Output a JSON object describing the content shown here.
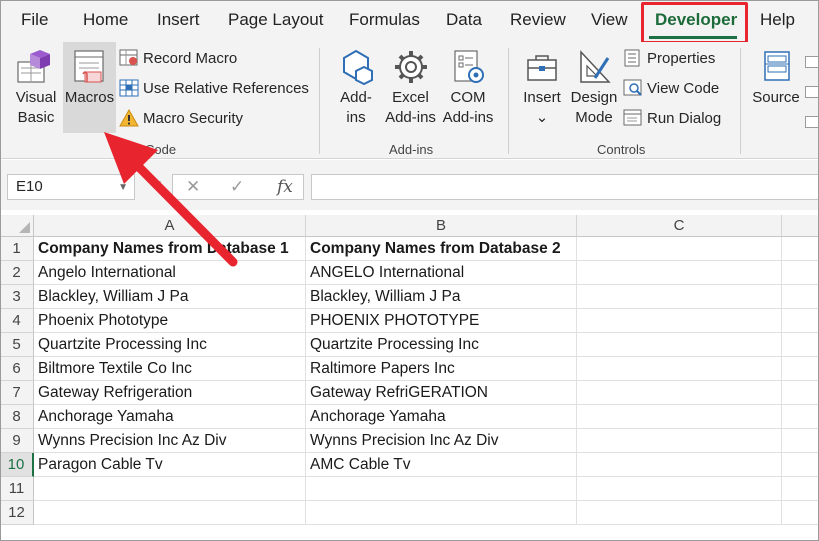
{
  "menu": {
    "tabs": [
      "File",
      "Home",
      "Insert",
      "Page Layout",
      "Formulas",
      "Data",
      "Review",
      "View",
      "Developer",
      "Help"
    ],
    "active_tab": "Developer"
  },
  "ribbon": {
    "code": {
      "group_label": "Code",
      "visual_basic": [
        "Visual",
        "Basic"
      ],
      "macros": "Macros",
      "record_macro": "Record Macro",
      "use_relative": "Use Relative References",
      "macro_security": "Macro Security"
    },
    "addins": {
      "group_label": "Add-ins",
      "addins_btn": [
        "Add-",
        "ins"
      ],
      "excel_addins": [
        "Excel",
        "Add-ins"
      ],
      "com_addins": [
        "COM",
        "Add-ins"
      ]
    },
    "controls": {
      "group_label": "Controls",
      "insert": "Insert",
      "insert_caret": "⌄",
      "design_mode": [
        "Design",
        "Mode"
      ],
      "properties": "Properties",
      "view_code": "View Code",
      "run_dialog": "Run Dialog"
    },
    "xml": {
      "source": "Source"
    }
  },
  "formula_bar": {
    "name_box": "E10",
    "cancel_icon": "✕",
    "enter_icon": "✓",
    "fx_label": "fx",
    "value": ""
  },
  "sheet": {
    "columns": [
      "A",
      "B",
      "C"
    ],
    "rows": [
      "1",
      "2",
      "3",
      "4",
      "5",
      "6",
      "7",
      "8",
      "9",
      "10",
      "11",
      "12"
    ],
    "selected_row": "10",
    "data": [
      [
        "Company Names from Database 1",
        "Company Names from Database 2"
      ],
      [
        "Angelo International",
        "ANGELO International"
      ],
      [
        "Blackley, William J Pa",
        "Blackley, William J Pa"
      ],
      [
        "Phoenix Phototype",
        "PHOENIX PHOTOTYPE"
      ],
      [
        "Quartzite Processing Inc",
        "Quartzite Processing Inc"
      ],
      [
        "Biltmore Textile Co Inc",
        "Raltimore Papers Inc"
      ],
      [
        "Gateway Refrigeration",
        "Gateway RefriGERATION"
      ],
      [
        "Anchorage Yamaha",
        "Anchorage Yamaha"
      ],
      [
        "Wynns Precision Inc Az Div",
        "Wynns Precision Inc Az Div"
      ],
      [
        "Paragon Cable Tv",
        "AMC Cable Tv"
      ]
    ]
  },
  "colors": {
    "accent_green": "#1e7145",
    "highlight_red": "#e8242f"
  }
}
